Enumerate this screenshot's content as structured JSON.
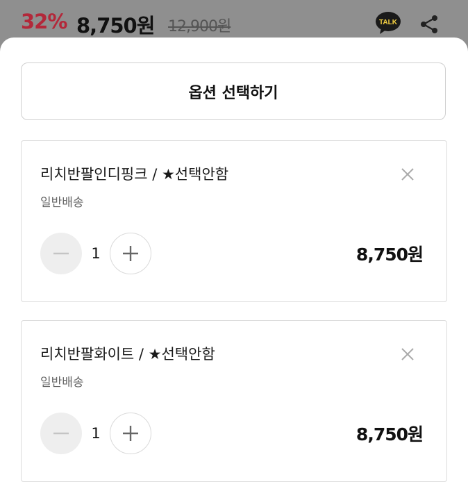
{
  "header": {
    "discount": "32%",
    "price": "8,750원",
    "original_price": "12,900원",
    "talk_label": "TALK",
    "share_icon": "share-icon"
  },
  "options_button": {
    "label": "옵션 선택하기"
  },
  "items": [
    {
      "name": "리치반팔인디핑크 / ★선택안함",
      "shipping": "일반배송",
      "quantity": "1",
      "price": "8,750원"
    },
    {
      "name": "리치반팔화이트 / ★선택안함",
      "shipping": "일반배송",
      "quantity": "1",
      "price": "8,750원"
    }
  ],
  "colors": {
    "discount": "#b3283a",
    "overlay": "#8f8f8f",
    "talk_bubble": "#1a1a1a",
    "talk_text": "#f5d142"
  }
}
